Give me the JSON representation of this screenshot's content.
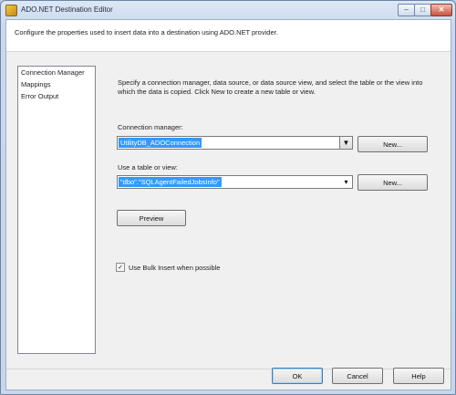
{
  "window": {
    "title": "ADO.NET Destination Editor",
    "controls": {
      "minimize": "–",
      "maximize": "□",
      "close": "✕"
    }
  },
  "header": {
    "description": "Configure the properties used to insert data into a destination using ADO.NET provider."
  },
  "nav": {
    "items": [
      {
        "label": "Connection Manager"
      },
      {
        "label": "Mappings"
      },
      {
        "label": "Error Output"
      }
    ]
  },
  "main": {
    "instructions": "Specify a connection manager, data source, or data source view, and select the table or the view into which the data is copied. Click New to create a new table or view.",
    "connection_manager": {
      "label": "Connection manager:",
      "value": "UtilityDB_ADOConnection",
      "new_button": "New..."
    },
    "table_or_view": {
      "label": "Use a table or view:",
      "value": "\"dbo\".\"SQLAgentFailedJobsInfo\"",
      "new_button": "New..."
    },
    "preview_button": "Preview",
    "bulk_insert": {
      "label": "Use Bulk Insert when possible",
      "checked": true
    }
  },
  "footer": {
    "ok": "OK",
    "cancel": "Cancel",
    "help": "Help"
  }
}
